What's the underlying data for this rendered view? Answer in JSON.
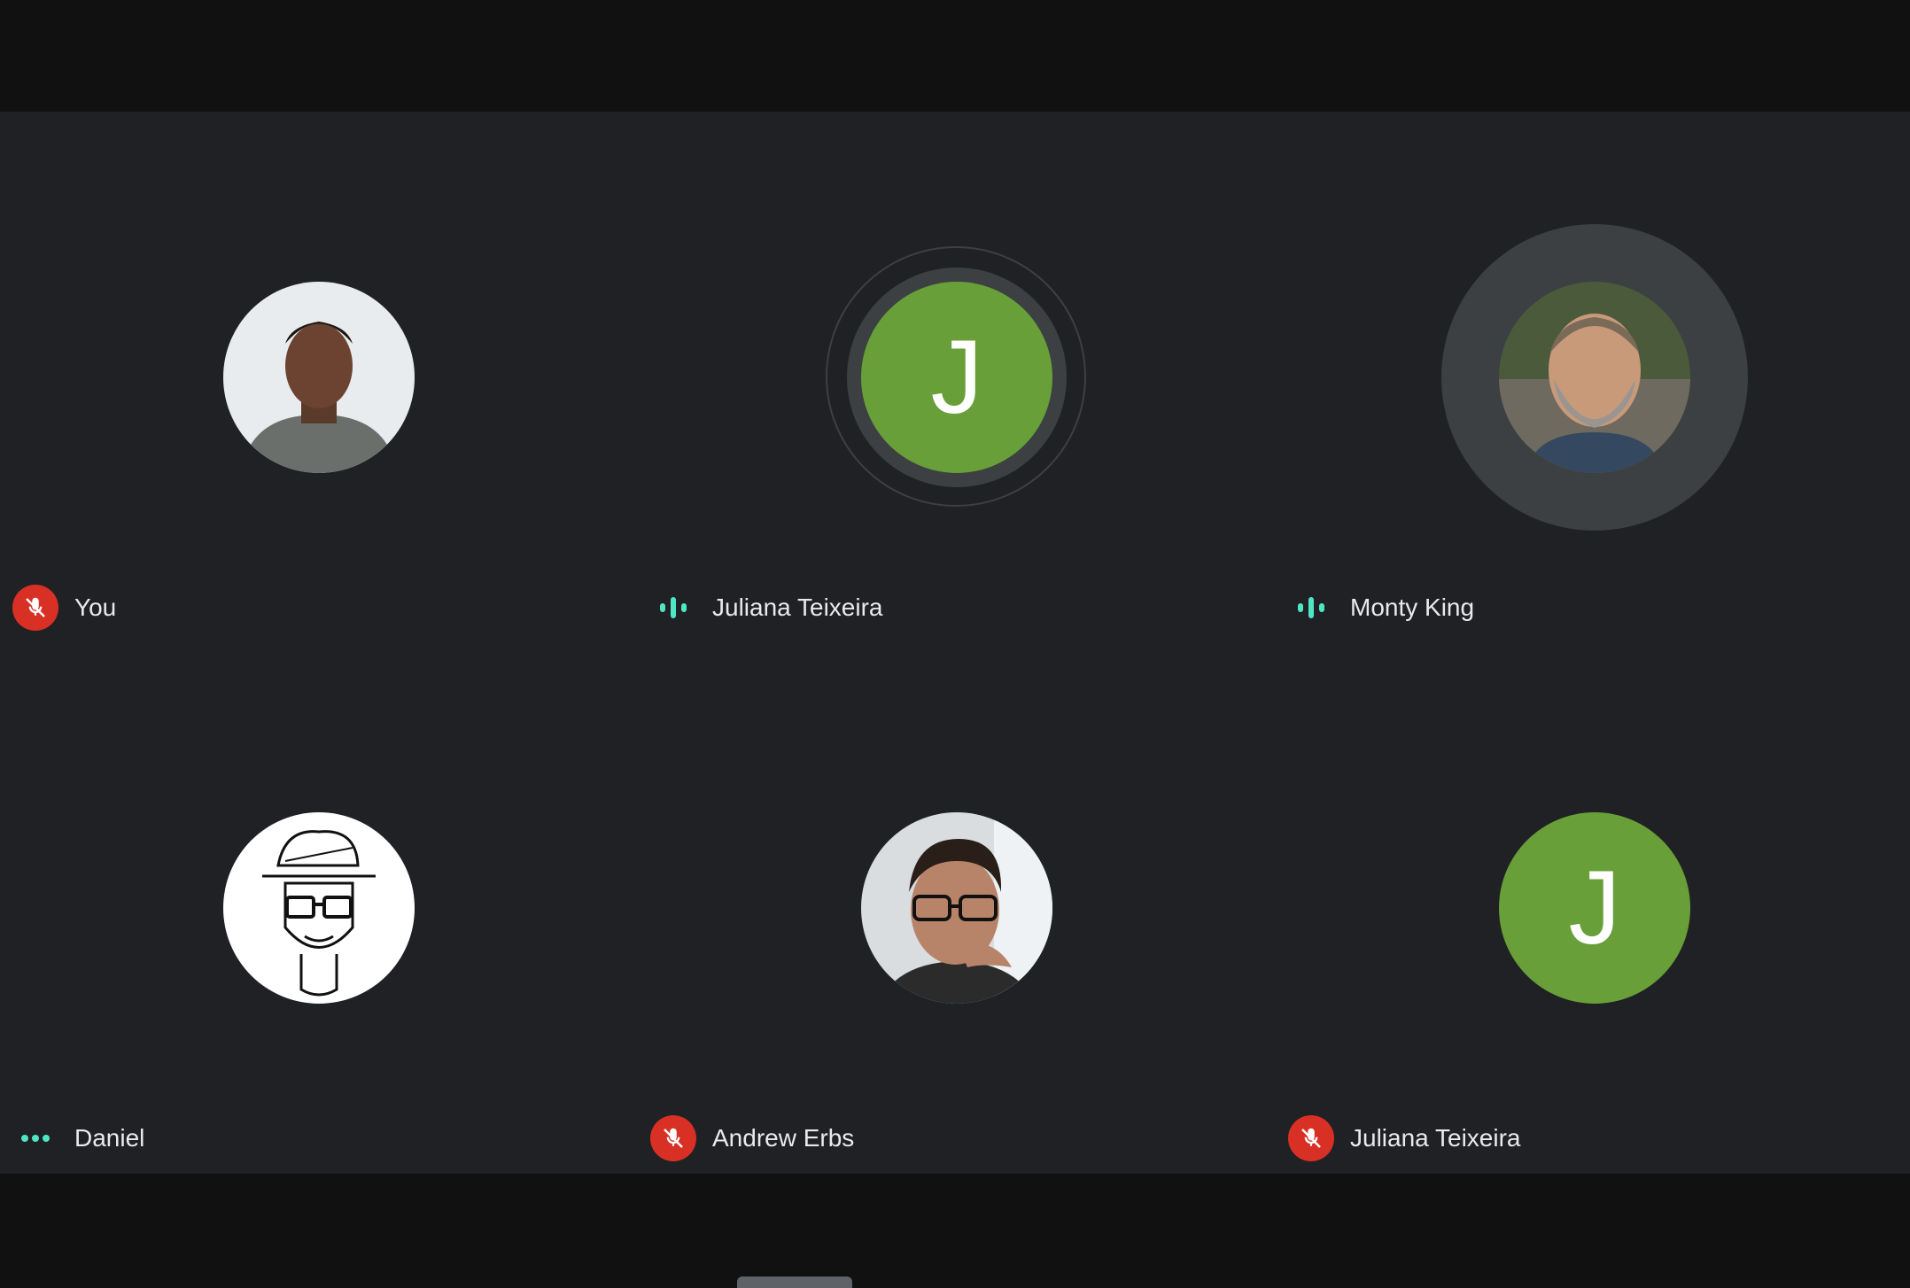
{
  "colors": {
    "background": "#202124",
    "chrome": "#111111",
    "muted_badge": "#d93025",
    "speaking_indicator": "#4ee6c5",
    "avatar_green": "#689f38"
  },
  "participants": [
    {
      "name": "You",
      "status": "muted",
      "status_icon": "mic-off-icon",
      "avatar": "photo"
    },
    {
      "name": "Juliana Teixeira",
      "status": "speaking",
      "status_icon": "audio-level-icon",
      "avatar": "letter",
      "initial": "J"
    },
    {
      "name": "Monty King",
      "status": "speaking",
      "status_icon": "audio-level-icon",
      "avatar": "photo"
    },
    {
      "name": "Daniel",
      "status": "connecting",
      "status_icon": "more-dots-icon",
      "avatar": "illustration"
    },
    {
      "name": "Andrew Erbs",
      "status": "muted",
      "status_icon": "mic-off-icon",
      "avatar": "photo"
    },
    {
      "name": "Juliana Teixeira",
      "status": "muted",
      "status_icon": "mic-off-icon",
      "avatar": "letter",
      "initial": "J"
    }
  ]
}
